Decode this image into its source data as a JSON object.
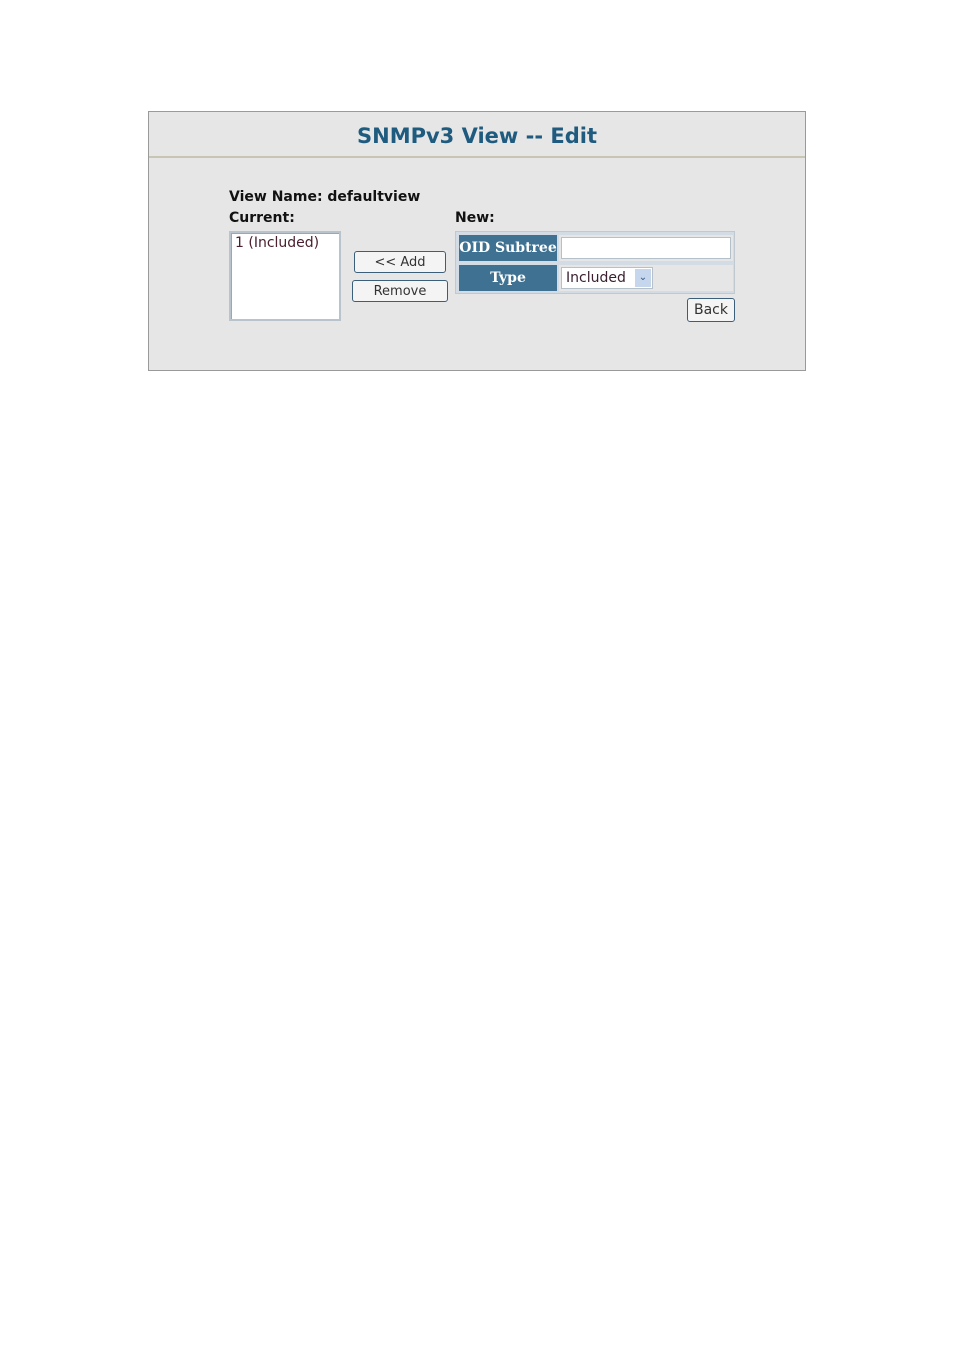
{
  "page": {
    "title": "SNMPv3 View -- Edit"
  },
  "view": {
    "name_label": "View Name: defaultview",
    "current_label": "Current:",
    "new_label": "New:",
    "current_items": [
      "1 (Included)"
    ]
  },
  "buttons": {
    "add": "<< Add",
    "remove": "Remove",
    "back": "Back"
  },
  "form": {
    "oid_label": "OID Subtree",
    "oid_value": "",
    "type_label": "Type",
    "type_value": "Included",
    "type_icon": "chevron-down-icon"
  },
  "colors": {
    "title": "#1f5b7f",
    "header_bg": "#3f7292",
    "panel_bg": "#e6e6e6"
  }
}
